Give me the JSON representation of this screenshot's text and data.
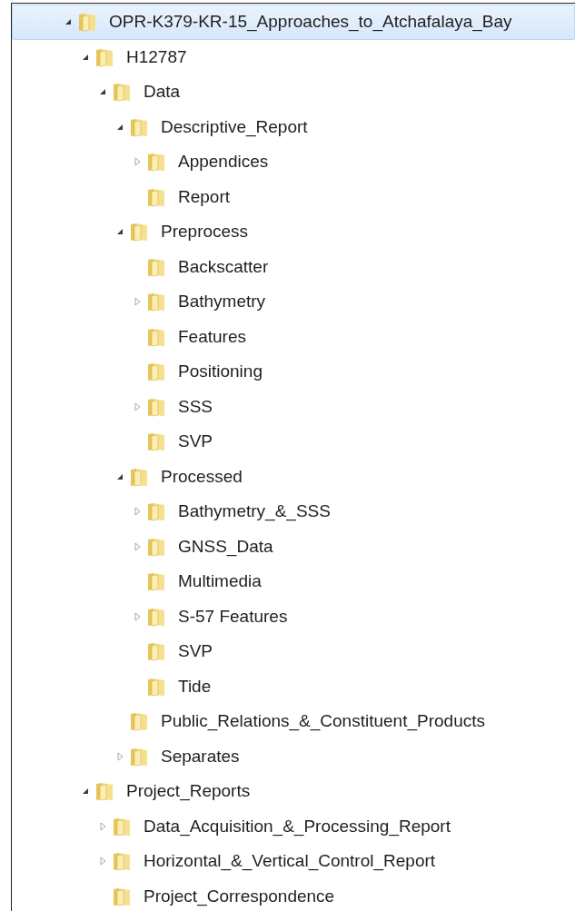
{
  "tree": [
    {
      "label": "OPR-K379-KR-15_Approaches_to_Atchafalaya_Bay",
      "selected": true,
      "expanded": true,
      "children": [
        {
          "label": "H12787",
          "selected": false,
          "expanded": true,
          "children": [
            {
              "label": "Data",
              "selected": false,
              "expanded": true,
              "children": [
                {
                  "label": "Descriptive_Report",
                  "selected": false,
                  "expanded": true,
                  "children": [
                    {
                      "label": "Appendices",
                      "selected": false,
                      "expanded": false
                    },
                    {
                      "label": "Report",
                      "selected": false
                    }
                  ]
                },
                {
                  "label": "Preprocess",
                  "selected": false,
                  "expanded": true,
                  "children": [
                    {
                      "label": "Backscatter",
                      "selected": false
                    },
                    {
                      "label": "Bathymetry",
                      "selected": false,
                      "expanded": false
                    },
                    {
                      "label": "Features",
                      "selected": false
                    },
                    {
                      "label": "Positioning",
                      "selected": false
                    },
                    {
                      "label": "SSS",
                      "selected": false,
                      "expanded": false
                    },
                    {
                      "label": "SVP",
                      "selected": false
                    }
                  ]
                },
                {
                  "label": "Processed",
                  "selected": false,
                  "expanded": true,
                  "children": [
                    {
                      "label": "Bathymetry_&_SSS",
                      "selected": false,
                      "expanded": false
                    },
                    {
                      "label": "GNSS_Data",
                      "selected": false,
                      "expanded": false
                    },
                    {
                      "label": "Multimedia",
                      "selected": false
                    },
                    {
                      "label": "S-57 Features",
                      "selected": false,
                      "expanded": false
                    },
                    {
                      "label": "SVP",
                      "selected": false
                    },
                    {
                      "label": "Tide",
                      "selected": false
                    }
                  ]
                },
                {
                  "label": "Public_Relations_&_Constituent_Products",
                  "selected": false
                },
                {
                  "label": "Separates",
                  "selected": false,
                  "expanded": false
                }
              ]
            }
          ]
        },
        {
          "label": "Project_Reports",
          "selected": false,
          "expanded": true,
          "children": [
            {
              "label": "Data_Acquisition_&_Processing_Report",
              "selected": false,
              "expanded": false
            },
            {
              "label": "Horizontal_&_Vertical_Control_Report",
              "selected": false,
              "expanded": false
            },
            {
              "label": "Project_Correspondence",
              "selected": false
            }
          ]
        }
      ]
    }
  ]
}
